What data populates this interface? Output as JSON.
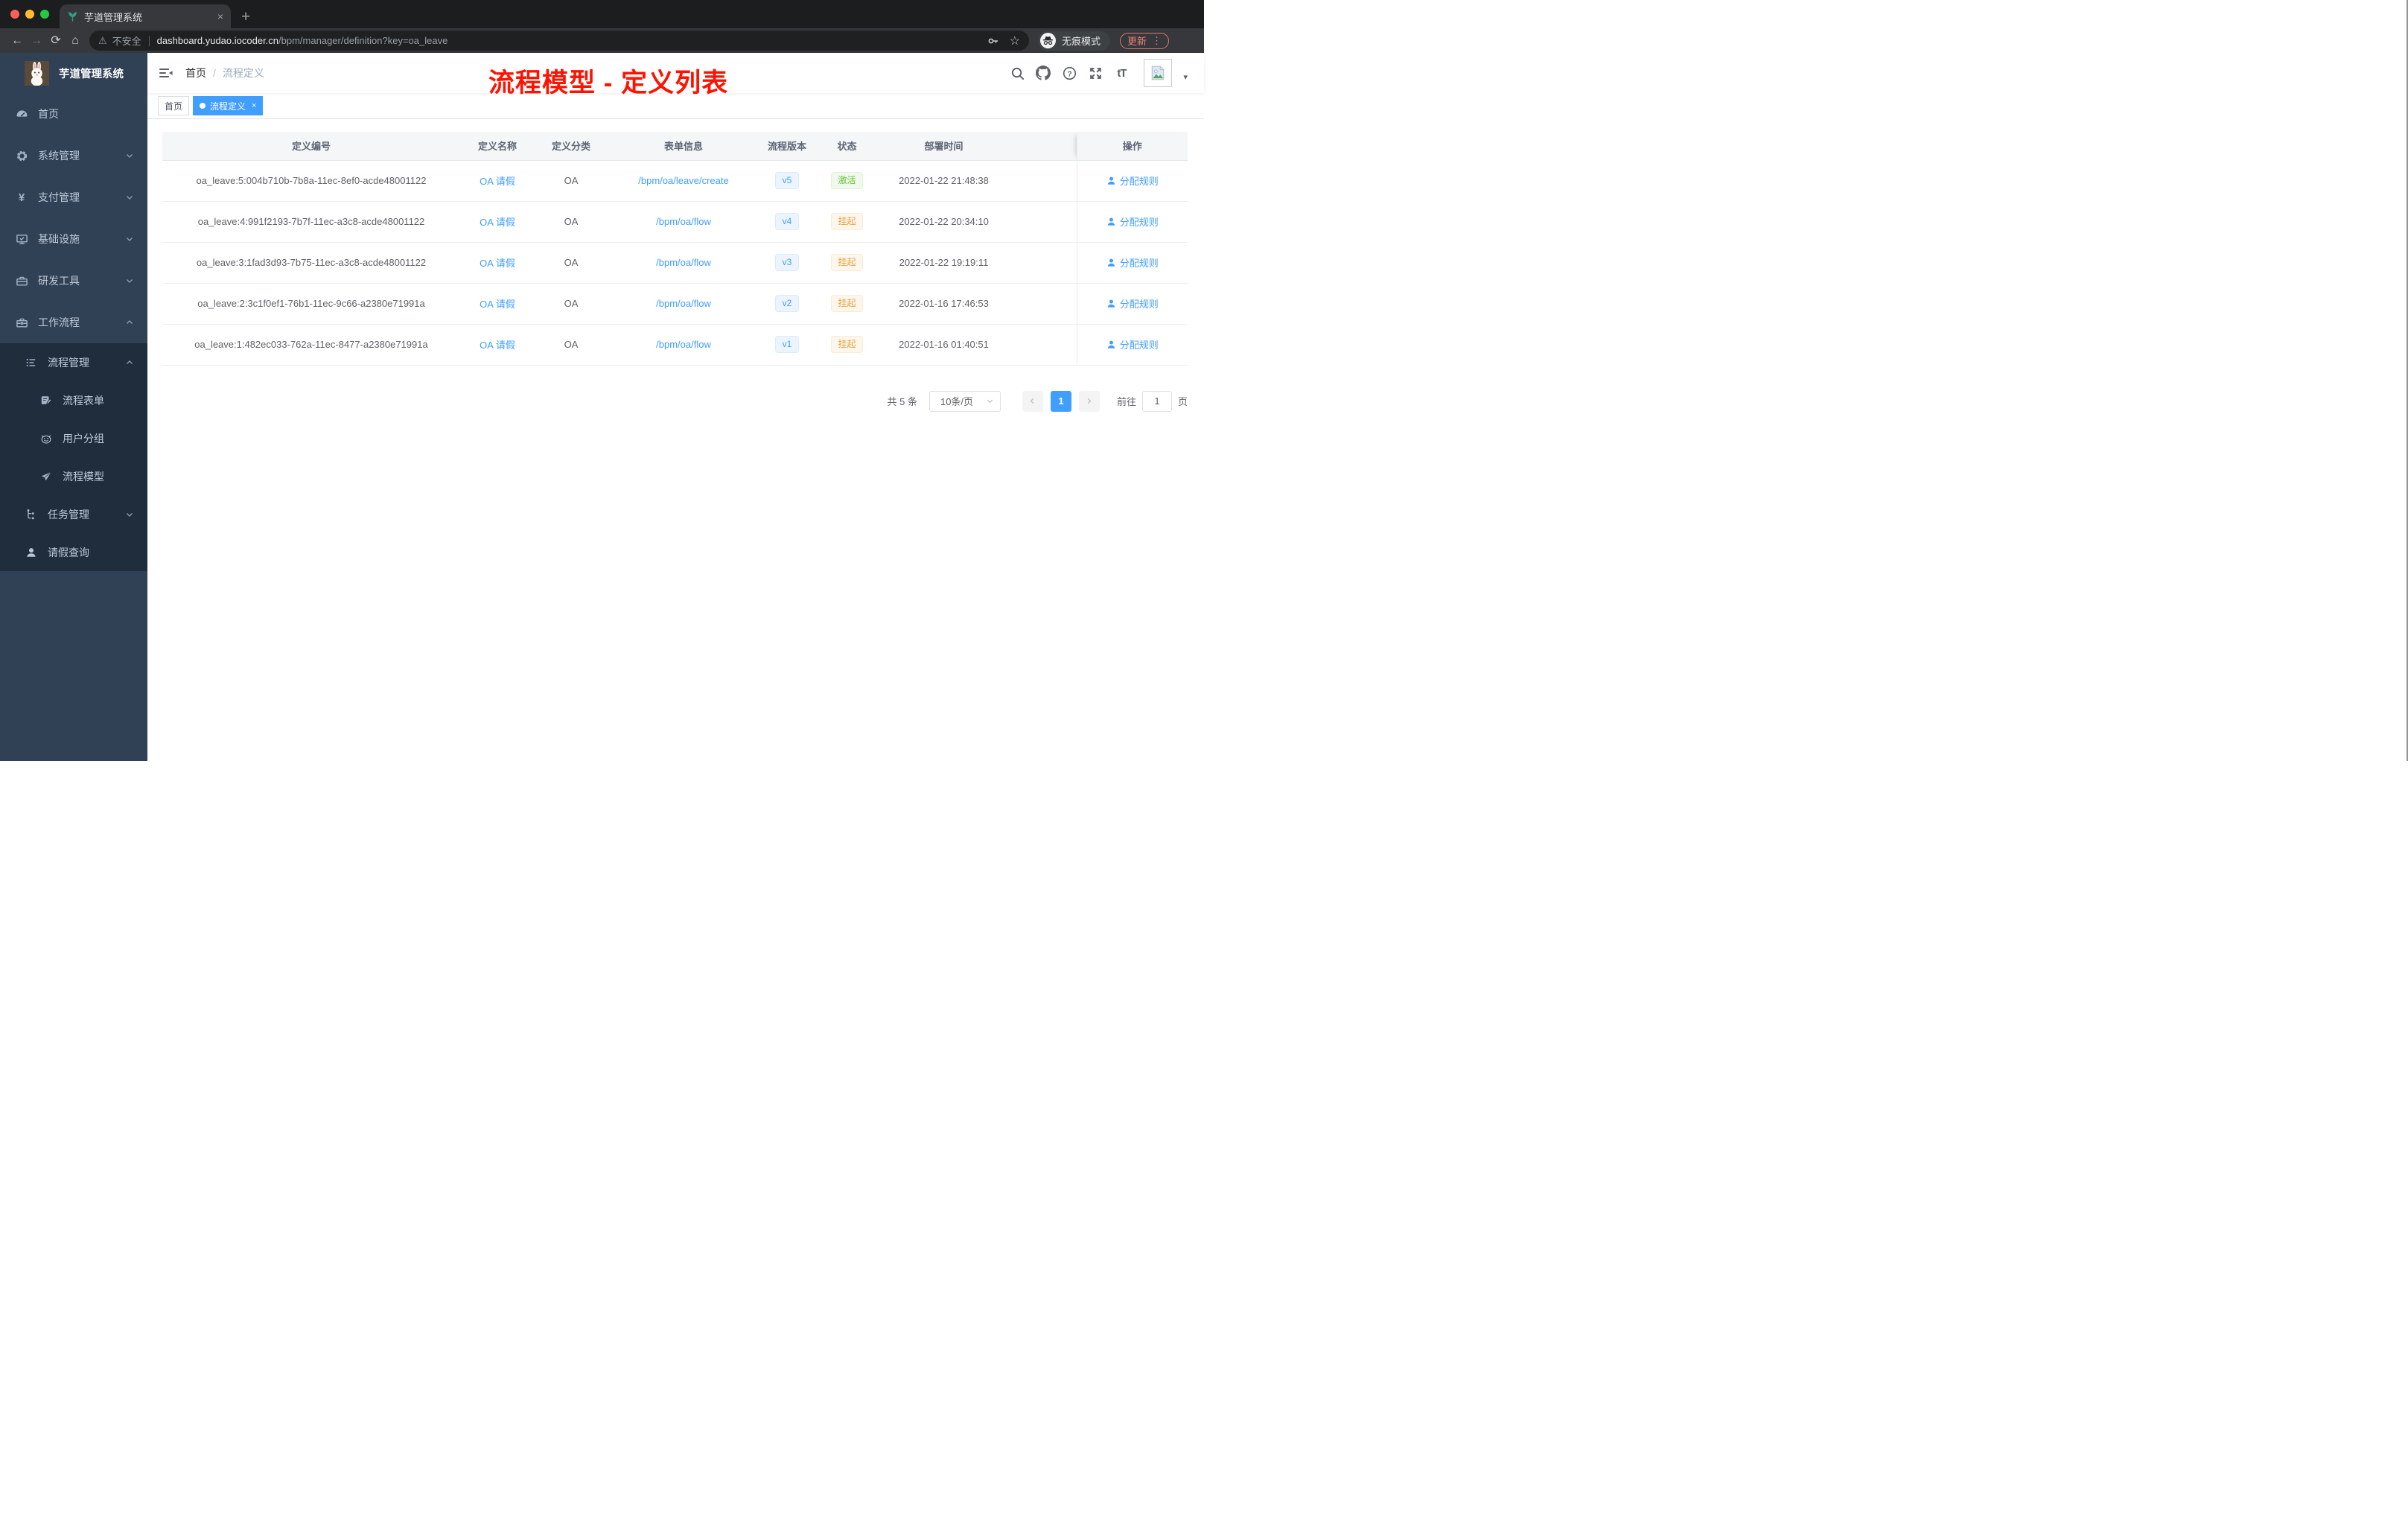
{
  "browser": {
    "tab_title": "芋道管理系统",
    "security_label": "不安全",
    "url_host": "dashboard.yudao.iocoder.cn",
    "url_path": "/bpm/manager/definition?key=oa_leave",
    "incognito_label": "无痕模式",
    "update_label": "更新"
  },
  "icons": {
    "close": "×",
    "plus": "+",
    "back": "←",
    "forward": "→",
    "reload": "⟳",
    "home": "⌂",
    "warning": "⚠",
    "kebab": "⋮",
    "star": "☆",
    "key": "⚷",
    "caret": "▾",
    "yen": "¥"
  },
  "sidebar": {
    "title": "芋道管理系统",
    "items": [
      {
        "label": "首页",
        "icon": "dashboard-icon",
        "arrow": ""
      },
      {
        "label": "系统管理",
        "icon": "gear-icon",
        "arrow": "down"
      },
      {
        "label": "支付管理",
        "icon": "yen-icon",
        "arrow": "down"
      },
      {
        "label": "基础设施",
        "icon": "monitor-icon",
        "arrow": "down"
      },
      {
        "label": "研发工具",
        "icon": "toolbox-icon",
        "arrow": "down"
      },
      {
        "label": "工作流程",
        "icon": "briefcase-icon",
        "arrow": "up"
      }
    ],
    "submenu": [
      {
        "label": "流程管理",
        "icon": "list-icon",
        "arrow": "up",
        "children": [
          {
            "label": "流程表单",
            "icon": "form-icon"
          },
          {
            "label": "用户分组",
            "icon": "robot-icon"
          },
          {
            "label": "流程模型",
            "icon": "paper-plane-icon"
          }
        ]
      },
      {
        "label": "任务管理",
        "icon": "tree-icon",
        "arrow": "down",
        "children": []
      },
      {
        "label": "请假查询",
        "icon": "user-icon",
        "arrow": "",
        "children": []
      }
    ]
  },
  "header": {
    "breadcrumb_home": "首页",
    "breadcrumb_sep": "/",
    "breadcrumb_current": "流程定义",
    "annotation": "流程模型 - 定义列表"
  },
  "tags": [
    {
      "label": "首页",
      "active": false
    },
    {
      "label": "流程定义",
      "active": true
    }
  ],
  "table": {
    "headers": [
      "定义编号",
      "定义名称",
      "定义分类",
      "表单信息",
      "流程版本",
      "状态",
      "部署时间",
      "操作"
    ],
    "rows": [
      {
        "id": "oa_leave:5:004b710b-7b8a-11ec-8ef0-acde48001122",
        "name": "OA 请假",
        "category": "OA",
        "form": "/bpm/oa/leave/create",
        "version": "v5",
        "status": "激活",
        "status_type": "success",
        "time": "2022-01-22 21:48:38",
        "action": "分配规则"
      },
      {
        "id": "oa_leave:4:991f2193-7b7f-11ec-a3c8-acde48001122",
        "name": "OA 请假",
        "category": "OA",
        "form": "/bpm/oa/flow",
        "version": "v4",
        "status": "挂起",
        "status_type": "warning",
        "time": "2022-01-22 20:34:10",
        "action": "分配规则"
      },
      {
        "id": "oa_leave:3:1fad3d93-7b75-11ec-a3c8-acde48001122",
        "name": "OA 请假",
        "category": "OA",
        "form": "/bpm/oa/flow",
        "version": "v3",
        "status": "挂起",
        "status_type": "warning",
        "time": "2022-01-22 19:19:11",
        "action": "分配规则"
      },
      {
        "id": "oa_leave:2:3c1f0ef1-76b1-11ec-9c66-a2380e71991a",
        "name": "OA 请假",
        "category": "OA",
        "form": "/bpm/oa/flow",
        "version": "v2",
        "status": "挂起",
        "status_type": "warning",
        "time": "2022-01-16 17:46:53",
        "action": "分配规则"
      },
      {
        "id": "oa_leave:1:482ec033-762a-11ec-8477-a2380e71991a",
        "name": "OA 请假",
        "category": "OA",
        "form": "/bpm/oa/flow",
        "version": "v1",
        "status": "挂起",
        "status_type": "warning",
        "time": "2022-01-16 01:40:51",
        "action": "分配规则"
      }
    ]
  },
  "pagination": {
    "total": "共 5 条",
    "page_size": "10条/页",
    "current": "1",
    "goto_prefix": "前往",
    "goto_value": "1",
    "goto_suffix": "页"
  },
  "colors": {
    "primary": "#409eff",
    "success": "#67c23a",
    "warning": "#e6a23c",
    "sidebar_bg": "#304156",
    "submenu_bg": "#1f2d3d",
    "annotation_red": "#ff1200",
    "update_red": "#ee8078",
    "traffic_red": "#ff5f57",
    "traffic_yellow": "#febc2e",
    "traffic_green": "#28c840"
  }
}
